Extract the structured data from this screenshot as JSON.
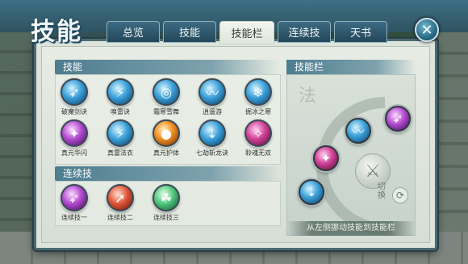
{
  "window": {
    "title": "技能",
    "close_icon": "close-icon"
  },
  "tabs": [
    {
      "label": "总览",
      "active": false
    },
    {
      "label": "技能",
      "active": false
    },
    {
      "label": "技能栏",
      "active": true
    },
    {
      "label": "连续技",
      "active": false
    },
    {
      "label": "天书",
      "active": false
    }
  ],
  "skills": {
    "header": "技能",
    "items": [
      {
        "label": "破魔剑诀",
        "icon": "blue-slash-icon",
        "color": "blue"
      },
      {
        "label": "唤雷诀",
        "icon": "lightning-icon",
        "color": "blue"
      },
      {
        "label": "霜寒雪舞",
        "icon": "vortex-icon",
        "color": "blue"
      },
      {
        "label": "逍遥游",
        "icon": "wind-step-icon",
        "color": "blue"
      },
      {
        "label": "掘冰之寒",
        "icon": "ice-shard-icon",
        "color": "blue"
      },
      {
        "label": "真元华闪",
        "icon": "purple-flash-icon",
        "color": "purple"
      },
      {
        "label": "真雷法衣",
        "icon": "thunder-robe-icon",
        "color": "blue"
      },
      {
        "label": "真元护体",
        "icon": "fire-shield-icon",
        "color": "orange"
      },
      {
        "label": "七劫斩龙诀",
        "icon": "sword-beam-icon",
        "color": "blue"
      },
      {
        "label": "聆魂无双",
        "icon": "soul-icon",
        "color": "magenta"
      }
    ]
  },
  "combos": {
    "header": "连续技",
    "items": [
      {
        "label": "连续技一",
        "icon": "combo-purple-icon",
        "color": "purple"
      },
      {
        "label": "连续技二",
        "icon": "combo-fire-icon",
        "color": "red"
      },
      {
        "label": "连续技三",
        "icon": "combo-green-icon",
        "color": "green"
      }
    ]
  },
  "skillbar": {
    "header": "技能栏",
    "toggle_text": "切换",
    "hint": "从左侧挪动技能到技能栏",
    "slots": [
      {
        "icon": "blue-slot-icon",
        "color": "blue"
      },
      {
        "icon": "purple-slot-icon",
        "color": "purple"
      },
      {
        "icon": "blue-slot-icon",
        "color": "blue"
      },
      {
        "icon": "fire-slot-icon",
        "color": "magenta"
      },
      {
        "icon": "blue-slot-icon",
        "color": "blue"
      }
    ]
  }
}
